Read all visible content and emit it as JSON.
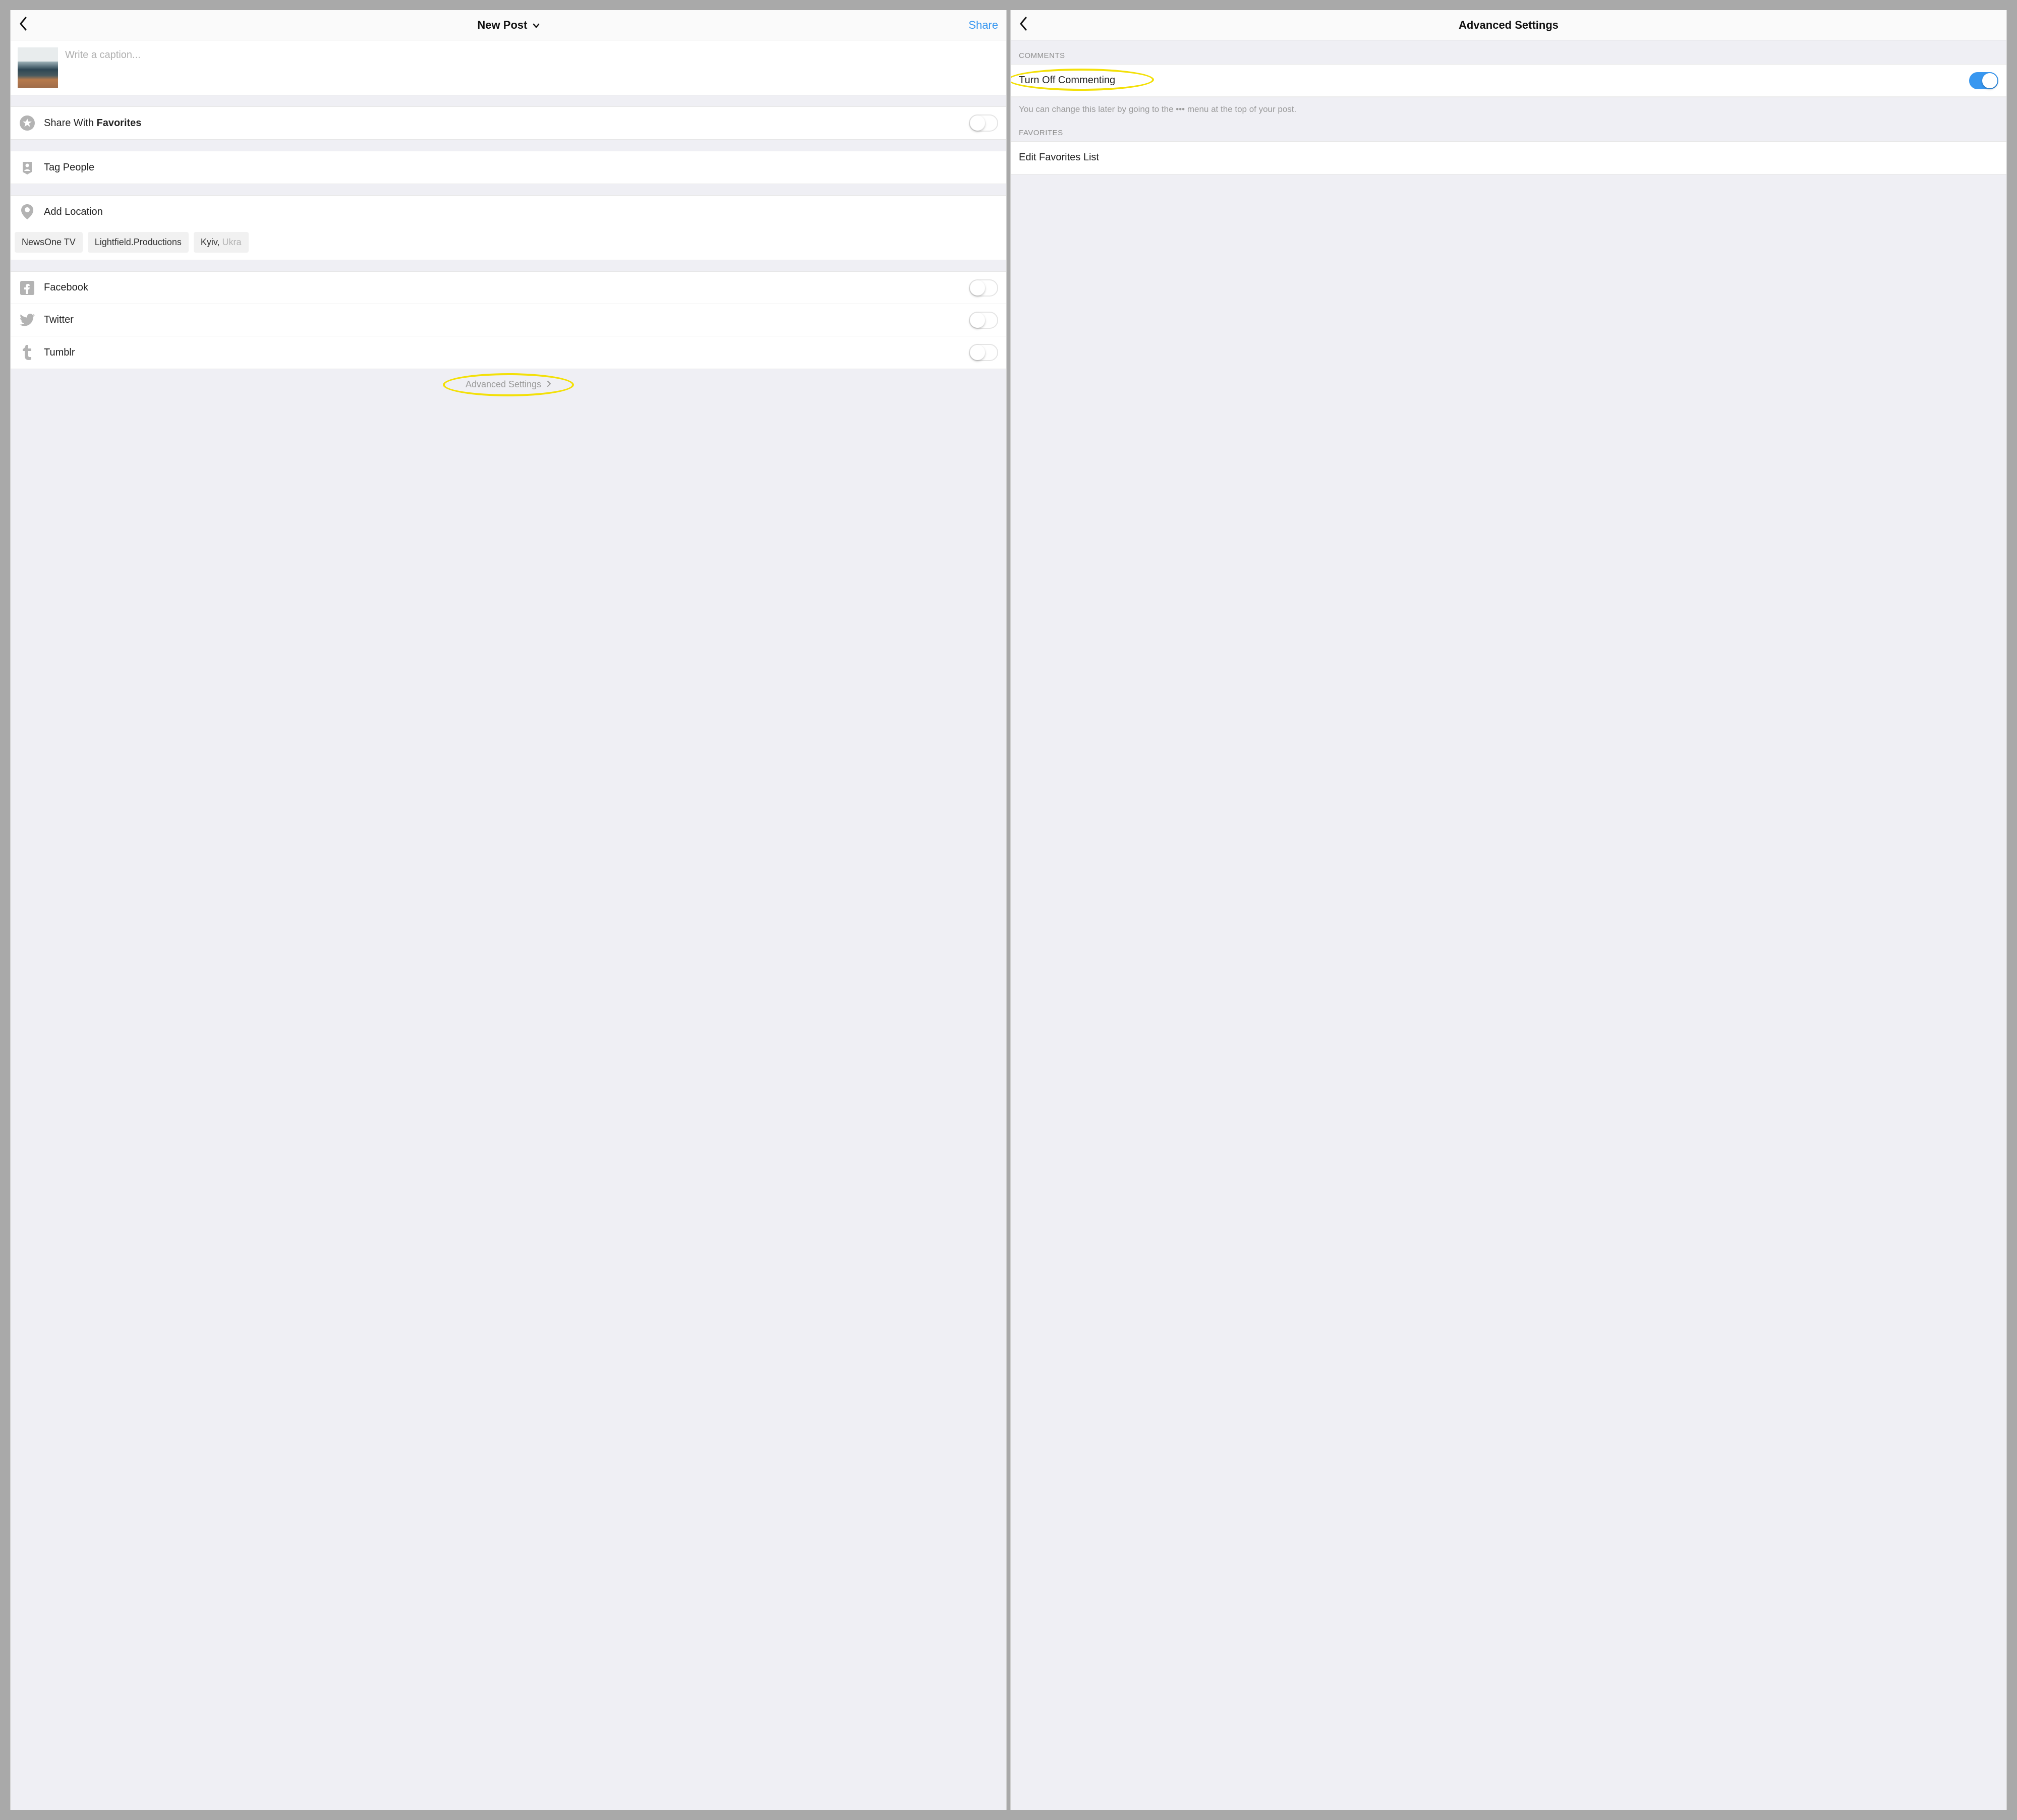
{
  "left": {
    "header": {
      "title": "New Post",
      "share": "Share"
    },
    "caption_placeholder": "Write a caption...",
    "share_with_prefix": "Share With ",
    "share_with_bold": "Favorites",
    "tag_people": "Tag People",
    "add_location": "Add Location",
    "location_chips": [
      "NewsOne TV",
      "Lightfield.Productions"
    ],
    "location_chip_cut_main": "Kyiv, ",
    "location_chip_cut_fade": "Ukra",
    "social": {
      "facebook": "Facebook",
      "twitter": "Twitter",
      "tumblr": "Tumblr"
    },
    "advanced": "Advanced Settings"
  },
  "right": {
    "header": {
      "title": "Advanced Settings"
    },
    "comments_header": "COMMENTS",
    "turn_off": "Turn Off Commenting",
    "hint": "You can change this later by going to the ••• menu at the top of your post.",
    "favorites_header": "FAVORITES",
    "edit_favorites": "Edit Favorites List"
  }
}
